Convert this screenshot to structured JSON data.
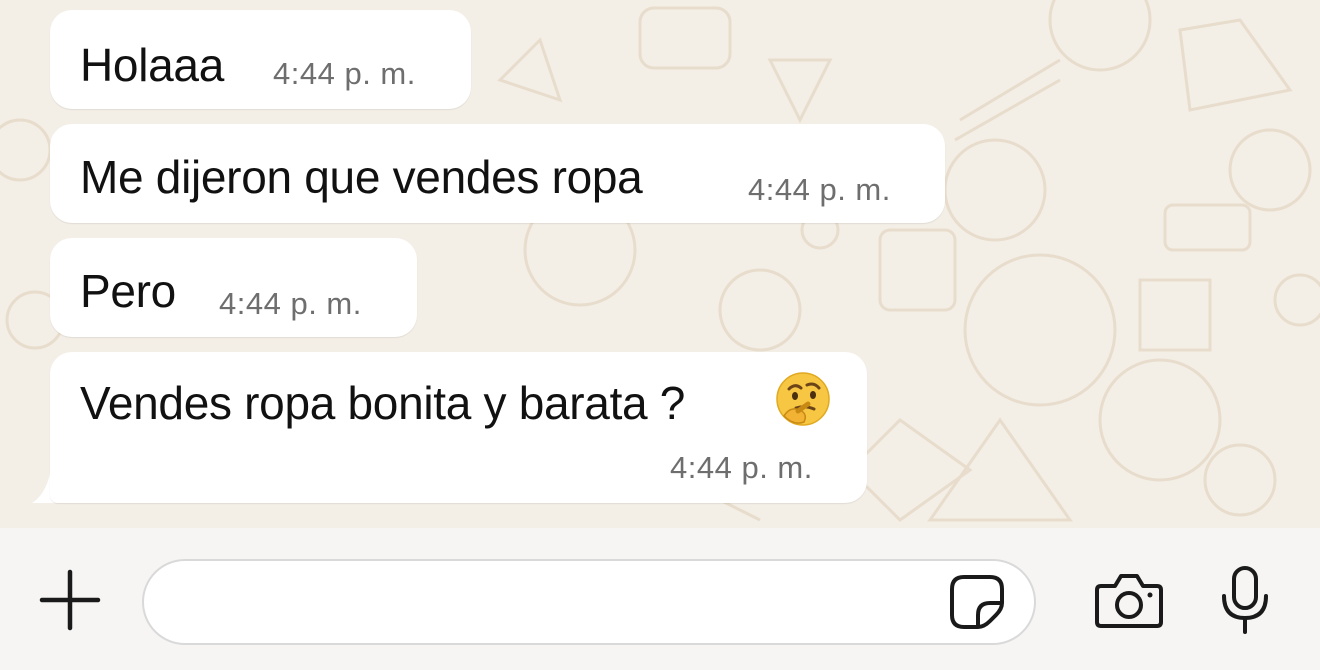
{
  "messages": [
    {
      "text": "Holaaa",
      "time": "4:44 p. m."
    },
    {
      "text": "Me dijeron que vendes ropa",
      "time": "4:44 p. m."
    },
    {
      "text": "Pero",
      "time": "4:44 p. m."
    },
    {
      "text": "Vendes ropa bonita y barata ?",
      "emoji": "thinking-face",
      "time": "4:44 p. m."
    }
  ],
  "composer": {
    "value": "",
    "placeholder": "",
    "icons": [
      "plus-icon",
      "sticker-icon",
      "camera-icon",
      "microphone-icon"
    ]
  },
  "colors": {
    "wallpaper": "#f3eee6",
    "doodle": "#e8ddcc",
    "bubble": "#ffffff",
    "timestamp": "#6e6e6e",
    "input_bar": "#f6f5f3"
  }
}
